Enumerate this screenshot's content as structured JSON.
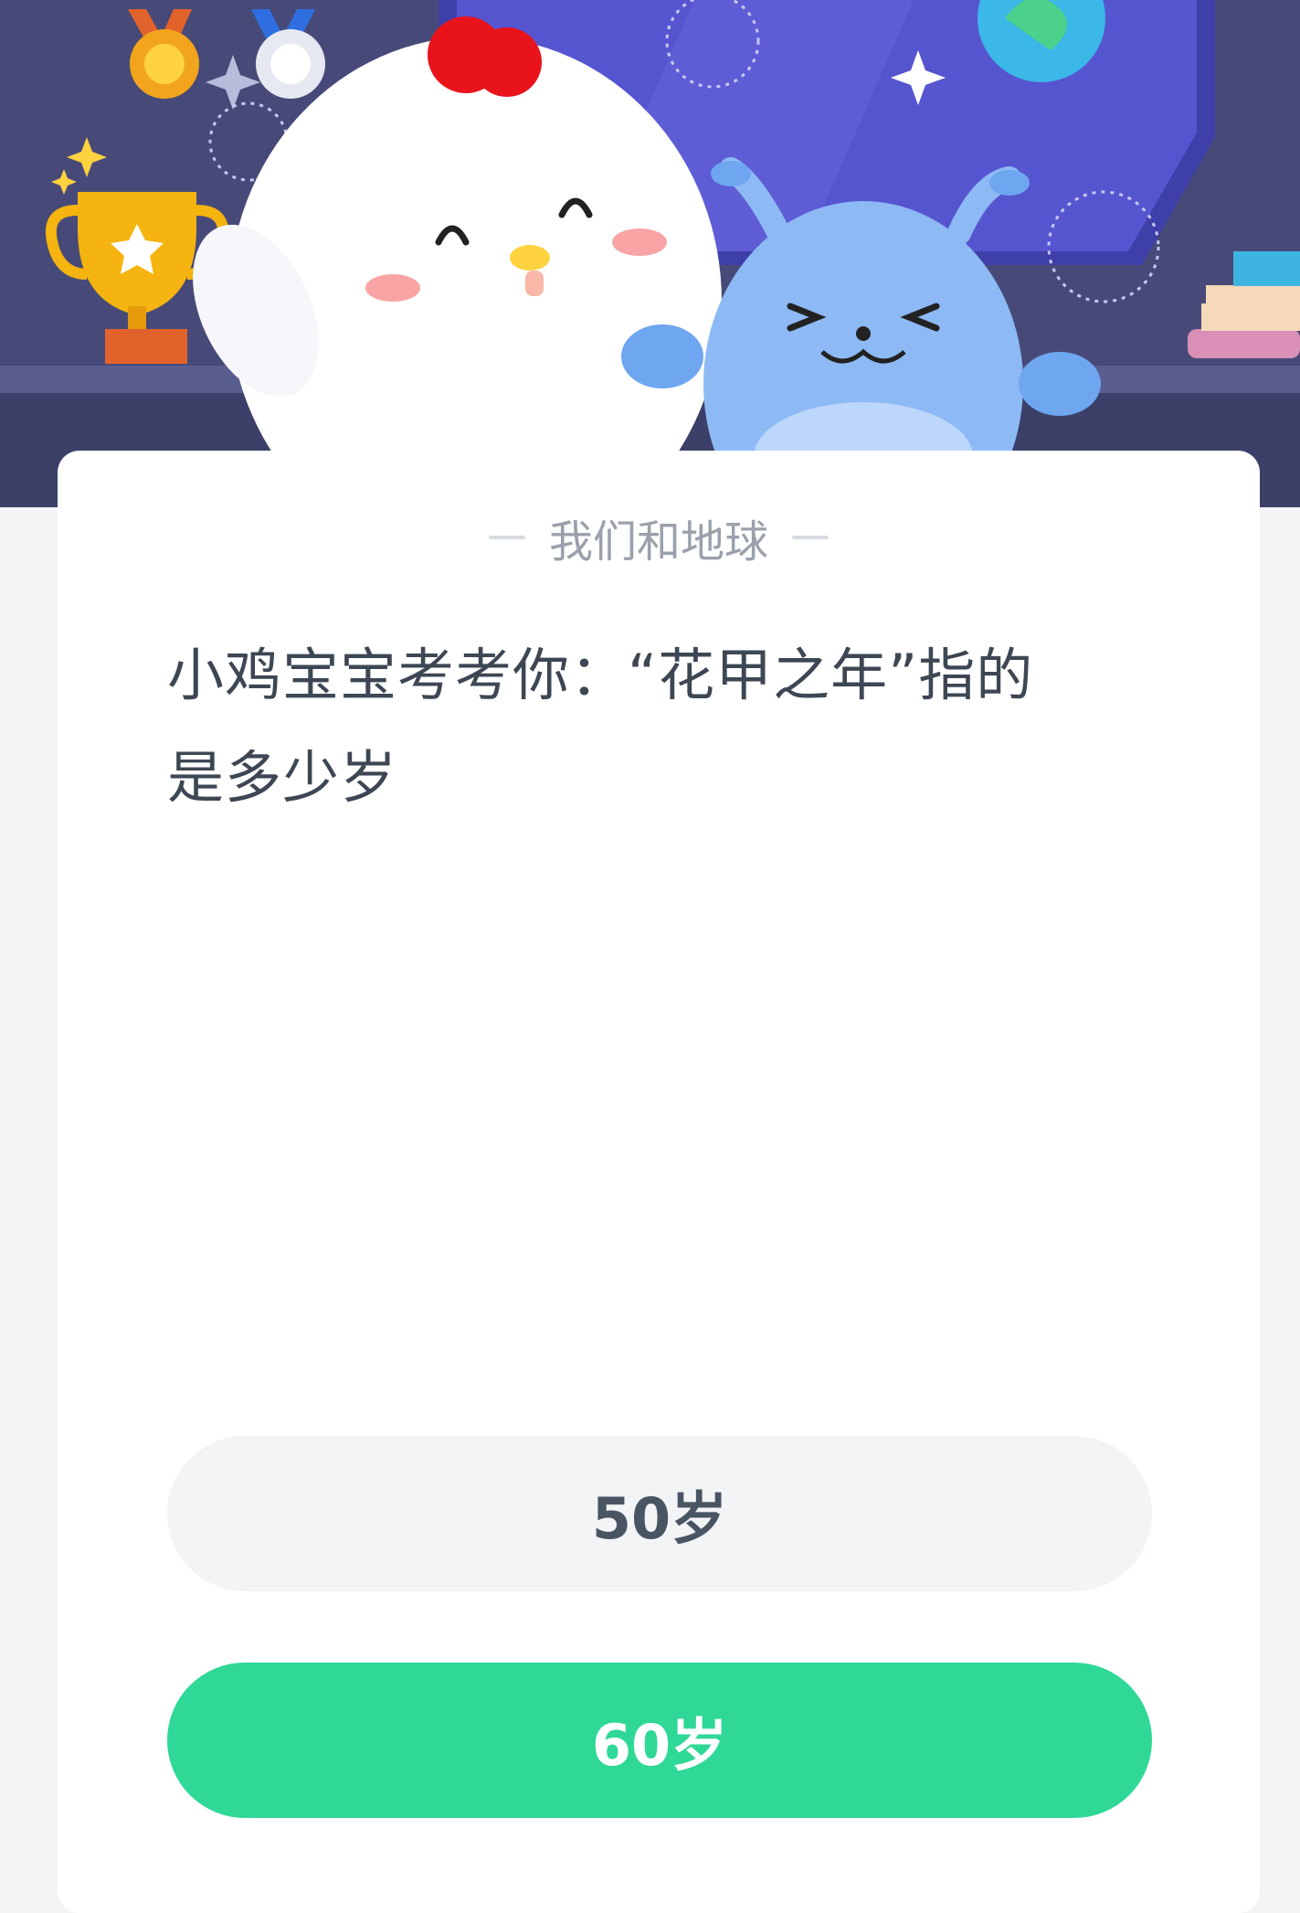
{
  "header": {
    "illustration": "mascot-chick-and-blue-alien-banner",
    "icons": [
      "bronze-medal-icon",
      "silver-medal-icon",
      "trophy-icon",
      "sparkle-icon",
      "globe-icon",
      "books-icon"
    ]
  },
  "card": {
    "category": "我们和地球",
    "question_line1": "小鸡宝宝考考你：“花甲之年”指的",
    "question_line2": "是多少岁"
  },
  "options": [
    {
      "label": "50岁",
      "style": "neutral"
    },
    {
      "label": "60岁",
      "style": "selected-green"
    }
  ],
  "colors": {
    "banner_bg": "#474a78",
    "accent_green": "#2fd897",
    "option_neutral": "#f2f4f6",
    "question_text": "#3d4754"
  }
}
